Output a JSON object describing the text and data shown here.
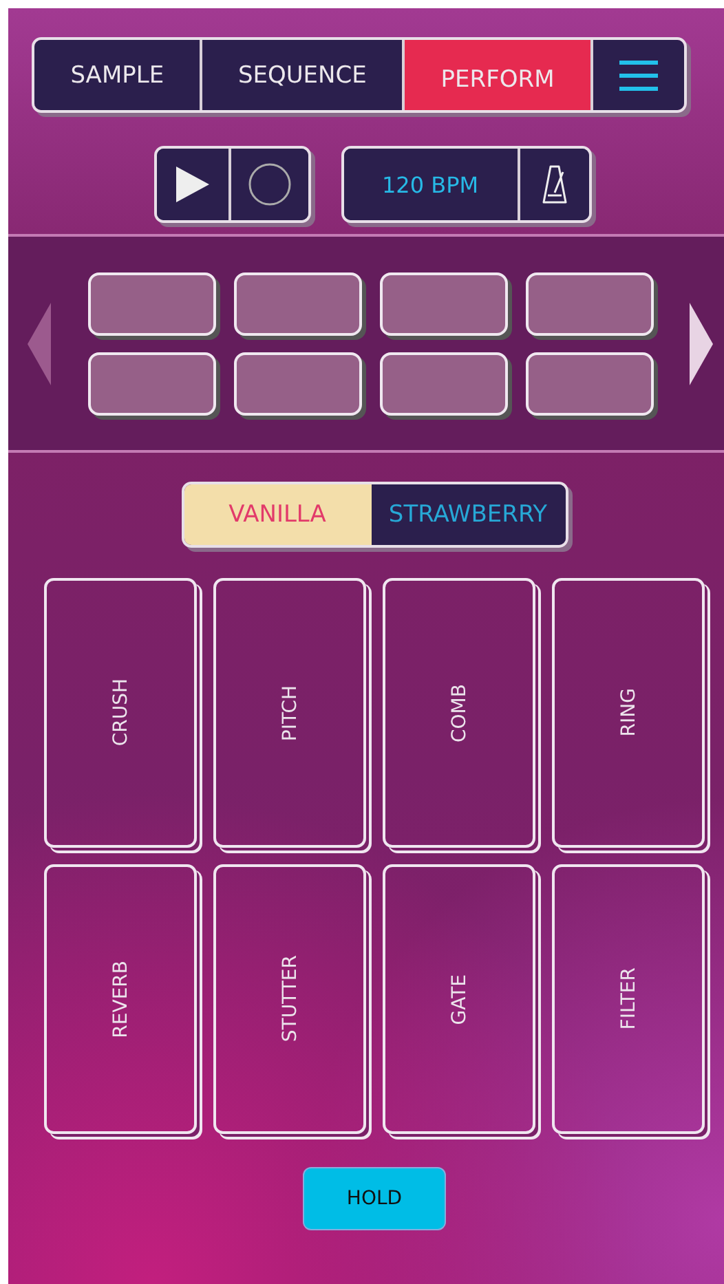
{
  "tabs": [
    {
      "label": "SAMPLE",
      "selected": false
    },
    {
      "label": "SEQUENCE",
      "selected": false
    },
    {
      "label": "PERFORM",
      "selected": true
    }
  ],
  "transport": {
    "tempo": "120 BPM"
  },
  "pads": [
    {
      "kind": "empty"
    },
    {
      "kind": "empty"
    },
    {
      "kind": "empty"
    },
    {
      "kind": "empty"
    },
    {
      "kind": "empty"
    },
    {
      "kind": "empty"
    },
    {
      "kind": "empty"
    },
    {
      "kind": "empty"
    }
  ],
  "modes": [
    {
      "label": "VANILLA",
      "selected": true
    },
    {
      "label": "STRAWBERRY",
      "selected": false
    }
  ],
  "effects": [
    {
      "label": "CRUSH"
    },
    {
      "label": "PITCH"
    },
    {
      "label": "COMB"
    },
    {
      "label": "RING"
    },
    {
      "label": "REVERB"
    },
    {
      "label": "STUTTER"
    },
    {
      "label": "GATE"
    },
    {
      "label": "FILTER"
    }
  ],
  "hold_button": {
    "label": "HOLD"
  }
}
